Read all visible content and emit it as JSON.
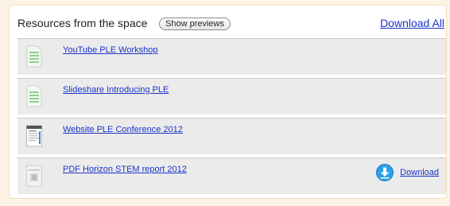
{
  "resources": {
    "title": "Resources from the space",
    "preview_button": "Show previews",
    "download_all": "Download All",
    "items": [
      {
        "name": "YouTube PLE Workshop",
        "thumb_icon": "spreadsheet-document-icon"
      },
      {
        "name": "Slideshare Introducing PLE",
        "thumb_icon": "spreadsheet-document-icon"
      },
      {
        "name": "Website PLE Conference 2012",
        "thumb_icon": "webpage-thumbnail-icon"
      },
      {
        "name": "PDF Horizon STEM report 2012",
        "thumb_icon": "pdf-thumbnail-icon",
        "download_label": "Download",
        "download_icon": "download-arrow-icon"
      }
    ]
  },
  "colors": {
    "link": "#1a33c8",
    "page_background": "#fdf3e4",
    "row_background": "#ebebeb",
    "download_circle": "#2a9fe8"
  }
}
